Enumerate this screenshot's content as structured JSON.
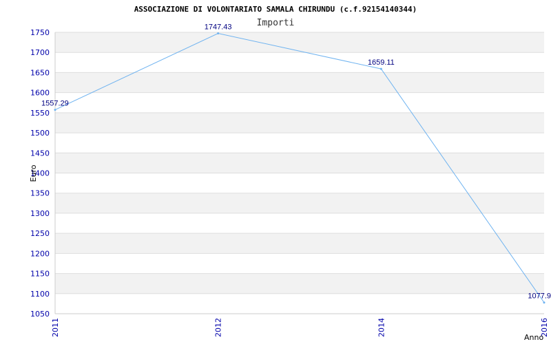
{
  "chart_data": {
    "type": "line",
    "title": "ASSOCIAZIONE DI VOLONTARIATO SAMALA CHIRUNDU (c.f.92154140344)",
    "subtitle": "Importi",
    "xlabel": "Anno",
    "ylabel": "Euro",
    "categories": [
      "2011",
      "2012",
      "2014",
      "2016"
    ],
    "values": [
      1557.29,
      1747.43,
      1659.11,
      1077.9
    ],
    "data_labels": [
      "1557.29",
      "1747.43",
      "1659.11",
      "1077.9"
    ],
    "ylim": [
      1050,
      1750
    ],
    "yticks": [
      "1050",
      "1100",
      "1150",
      "1200",
      "1250",
      "1300",
      "1350",
      "1400",
      "1450",
      "1500",
      "1550",
      "1600",
      "1650",
      "1700",
      "1750"
    ],
    "grid": true,
    "line_color": "#6fb3f0",
    "band_colors": [
      "#f2f2f2",
      "#ffffff"
    ],
    "tick_color": "#0000aa",
    "data_label_color": "#000080"
  }
}
